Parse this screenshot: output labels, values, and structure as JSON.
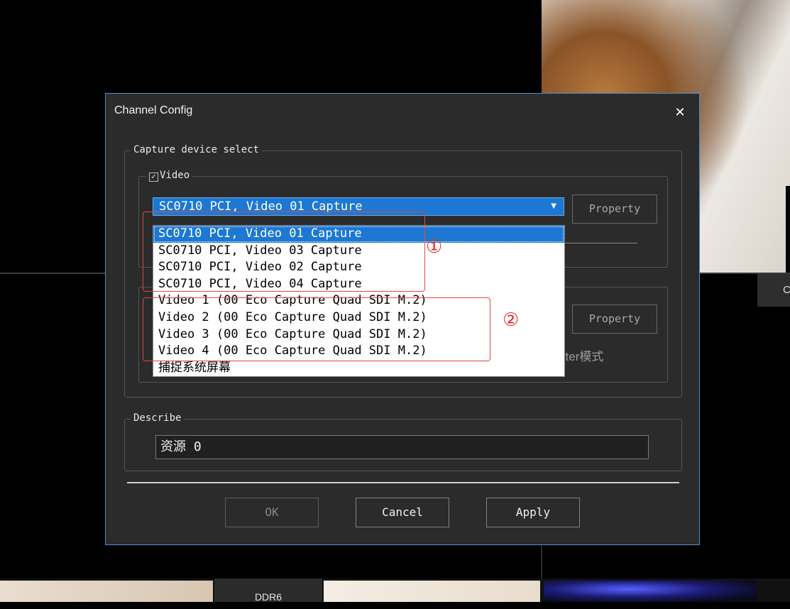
{
  "dialog": {
    "title": "Channel Config",
    "close_icon": "close-icon"
  },
  "capture_group": {
    "legend": "Capture device select"
  },
  "video_group": {
    "checkbox_checked": true,
    "label": "Video",
    "selected_device": "SC0710 PCI, Video 01 Capture",
    "property_label": "Property"
  },
  "audio_group": {
    "property_label": "Property",
    "filter_mode_partial": "ilter模式"
  },
  "dropdown": {
    "items": [
      "SC0710 PCI, Video 01 Capture",
      "SC0710 PCI, Video 03 Capture",
      "SC0710 PCI, Video 02 Capture",
      "SC0710 PCI, Video 04 Capture",
      "Video 1 (00 Eco Capture Quad SDI M.2)",
      "Video 2 (00 Eco Capture Quad SDI M.2)",
      "Video 3 (00 Eco Capture Quad SDI M.2)",
      "Video 4 (00 Eco Capture Quad SDI M.2)",
      "捕捉系统屏幕"
    ],
    "selected_index": 0
  },
  "annotations": {
    "marker_1": "①",
    "marker_2": "②",
    "color": "#e64545"
  },
  "describe_group": {
    "legend": "Describe",
    "value": "资源 0"
  },
  "buttons": {
    "ok": "OK",
    "cancel": "Cancel",
    "apply": "Apply"
  },
  "background": {
    "side_tab_label": "C",
    "bottom_tab_label": "DDR6"
  },
  "colors": {
    "accent": "#1c78d3",
    "dialog_bg": "#2b2b2b",
    "dialog_border": "#4b8fd6"
  }
}
